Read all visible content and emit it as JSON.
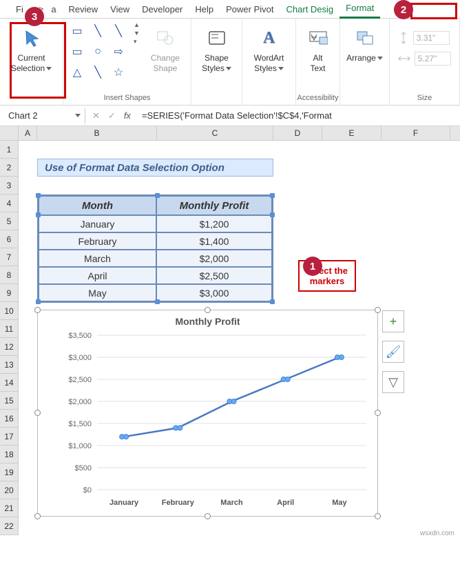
{
  "ribbon_tabs": {
    "fi": "Fi",
    "a": "a",
    "review": "Review",
    "view": "View",
    "developer": "Developer",
    "help": "Help",
    "powerpivot": "Power Pivot",
    "chartdesign": "Chart Desig",
    "format": "Format"
  },
  "ribbon": {
    "current_selection": "Current\nSelection",
    "change_shape": "Change\nShape",
    "shape_styles": "Shape\nStyles",
    "wordart_styles": "WordArt\nStyles",
    "alt_text": "Alt\nText",
    "arrange": "Arrange",
    "group_insert": "Insert Shapes",
    "group_acc": "Accessibility",
    "group_size": "Size",
    "h_val": "3.31\"",
    "w_val": "5.27\""
  },
  "namebox": "Chart 2",
  "formula": "=SERIES('Format Data Selection'!$C$4,'Format",
  "cols": {
    "A": "A",
    "B": "B",
    "C": "C",
    "D": "D",
    "E": "E",
    "F": "F"
  },
  "rows": [
    "1",
    "2",
    "3",
    "4",
    "5",
    "6",
    "7",
    "8",
    "9",
    "10",
    "11",
    "12",
    "13",
    "14",
    "15",
    "16",
    "17",
    "18",
    "19",
    "20",
    "21",
    "22"
  ],
  "title_cell": "Use of Format Data Selection Option",
  "table": {
    "h1": "Month",
    "h2": "Monthly Profit",
    "r": [
      {
        "m": "January",
        "p": "$1,200"
      },
      {
        "m": "February",
        "p": "$1,400"
      },
      {
        "m": "March",
        "p": "$2,000"
      },
      {
        "m": "April",
        "p": "$2,500"
      },
      {
        "m": "May",
        "p": "$3,000"
      }
    ]
  },
  "callout_text": "select the\nmarkers",
  "badges": {
    "b1": "1",
    "b2": "2",
    "b3": "3"
  },
  "chart_data": {
    "type": "line",
    "title": "Monthly Profit",
    "categories": [
      "January",
      "February",
      "March",
      "April",
      "May"
    ],
    "values": [
      1200,
      1400,
      2000,
      2500,
      3000
    ],
    "ylim": [
      0,
      3500
    ],
    "ystep": 500,
    "yticks": [
      "$0",
      "$500",
      "$1,000",
      "$1,500",
      "$2,000",
      "$2,500",
      "$3,000",
      "$3,500"
    ]
  },
  "watermark": "wsxdn.com"
}
